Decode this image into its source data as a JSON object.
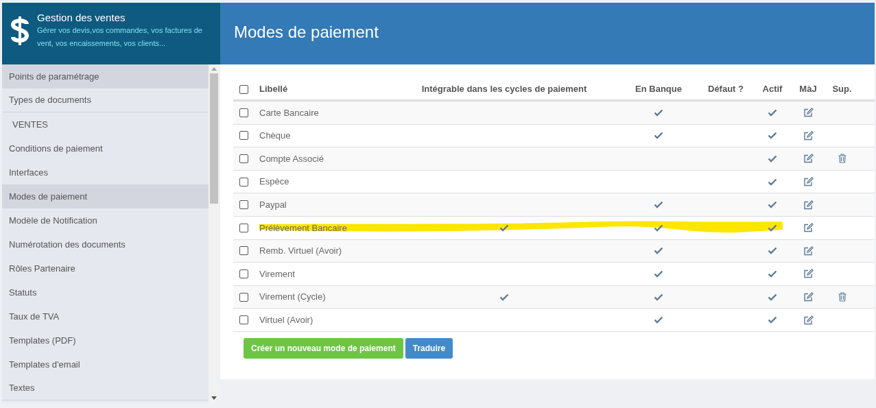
{
  "app": {
    "title": "Gestion des ventes",
    "subtitle": "Gérer vos devis,vos commandes, vos factures de vent, vos encaissements, vos clients..."
  },
  "sidebar": {
    "items": [
      {
        "label": "Points de paramétrage",
        "kind": "section",
        "selected": true
      },
      {
        "label": "Types de documents",
        "kind": "item",
        "selected": false
      },
      {
        "label": "VENTES",
        "kind": "heading",
        "selected": false
      },
      {
        "label": "Conditions de paiement",
        "kind": "item",
        "selected": false
      },
      {
        "label": "Interfaces",
        "kind": "item",
        "selected": false
      },
      {
        "label": "Modes de paiement",
        "kind": "item",
        "selected": true
      },
      {
        "label": "Modèle de Notification",
        "kind": "item",
        "selected": false
      },
      {
        "label": "Numérotation des documents",
        "kind": "item",
        "selected": false
      },
      {
        "label": "Rôles Partenaire",
        "kind": "item",
        "selected": false
      },
      {
        "label": "Statuts",
        "kind": "item",
        "selected": false
      },
      {
        "label": "Taux de TVA",
        "kind": "item",
        "selected": false
      },
      {
        "label": "Templates (PDF)",
        "kind": "item",
        "selected": false
      },
      {
        "label": "Templates d'email",
        "kind": "item",
        "selected": false
      },
      {
        "label": "Textes",
        "kind": "item",
        "selected": false
      }
    ]
  },
  "page_title": "Modes de paiement",
  "table": {
    "select_all": {
      "checked": false
    },
    "columns": [
      "Libellé",
      "Intégrable dans les cycles de paiement",
      "En Banque",
      "Défaut ?",
      "Actif",
      "MàJ",
      "Sup."
    ],
    "rows": [
      {
        "label": "Carte Bancaire",
        "checked": false,
        "integrable": false,
        "en_banque": true,
        "defaut": false,
        "actif": true,
        "deletable": false,
        "highlighted": false
      },
      {
        "label": "Chèque",
        "checked": false,
        "integrable": false,
        "en_banque": true,
        "defaut": false,
        "actif": true,
        "deletable": false,
        "highlighted": false
      },
      {
        "label": "Compte Associé",
        "checked": false,
        "integrable": false,
        "en_banque": false,
        "defaut": false,
        "actif": true,
        "deletable": true,
        "highlighted": false
      },
      {
        "label": "Espèce",
        "checked": false,
        "integrable": false,
        "en_banque": false,
        "defaut": false,
        "actif": true,
        "deletable": false,
        "highlighted": false
      },
      {
        "label": "Paypal",
        "checked": false,
        "integrable": false,
        "en_banque": true,
        "defaut": false,
        "actif": true,
        "deletable": false,
        "highlighted": false
      },
      {
        "label": "Prélèvement Bancaire",
        "checked": false,
        "integrable": true,
        "en_banque": true,
        "defaut": false,
        "actif": true,
        "deletable": false,
        "highlighted": true
      },
      {
        "label": "Remb. Virtuel (Avoir)",
        "checked": false,
        "integrable": false,
        "en_banque": true,
        "defaut": false,
        "actif": true,
        "deletable": false,
        "highlighted": false
      },
      {
        "label": "Virement",
        "checked": false,
        "integrable": false,
        "en_banque": true,
        "defaut": false,
        "actif": true,
        "deletable": false,
        "highlighted": false
      },
      {
        "label": "Virement (Cycle)",
        "checked": false,
        "integrable": true,
        "en_banque": true,
        "defaut": false,
        "actif": true,
        "deletable": true,
        "highlighted": false
      },
      {
        "label": "Virtuel (Avoir)",
        "checked": false,
        "integrable": false,
        "en_banque": true,
        "defaut": false,
        "actif": true,
        "deletable": false,
        "highlighted": false
      }
    ]
  },
  "buttons": [
    {
      "label": "Créer un nouveau mode de paiement",
      "kind": "success"
    },
    {
      "label": "Traduire",
      "kind": "primary"
    }
  ]
}
